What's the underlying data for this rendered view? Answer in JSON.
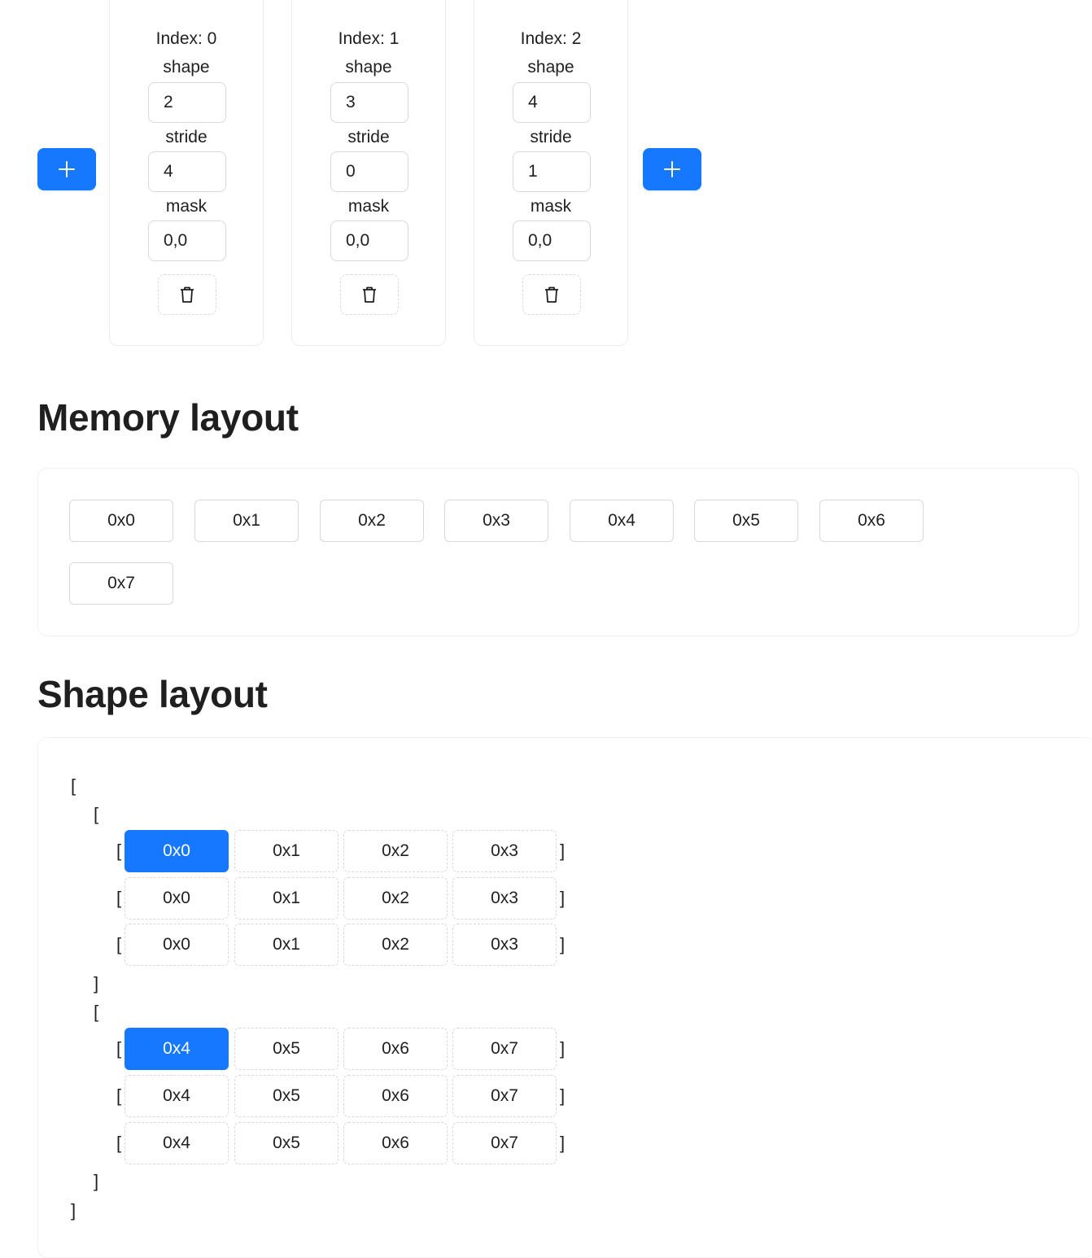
{
  "dimensions": [
    {
      "index_label": "Index: 0",
      "shape_label": "shape",
      "shape_value": "2",
      "stride_label": "stride",
      "stride_value": "4",
      "mask_label": "mask",
      "mask_value": "0,0"
    },
    {
      "index_label": "Index: 1",
      "shape_label": "shape",
      "shape_value": "3",
      "stride_label": "stride",
      "stride_value": "0",
      "mask_label": "mask",
      "mask_value": "0,0"
    },
    {
      "index_label": "Index: 2",
      "shape_label": "shape",
      "shape_value": "4",
      "stride_label": "stride",
      "stride_value": "1",
      "mask_label": "mask",
      "mask_value": "0,0"
    }
  ],
  "icons": {
    "add": "plus-icon",
    "delete": "trash-icon"
  },
  "colors": {
    "accent": "#1677ff",
    "border": "#d9d9d9",
    "text": "#1f1f1f"
  },
  "memory_layout": {
    "title": "Memory layout",
    "cells": [
      "0x0",
      "0x1",
      "0x2",
      "0x3",
      "0x4",
      "0x5",
      "0x6",
      "0x7"
    ]
  },
  "shape_layout": {
    "title": "Shape layout",
    "open_bracket": "[",
    "close_bracket": "]",
    "blocks": [
      {
        "rows": [
          {
            "cells": [
              "0x0",
              "0x1",
              "0x2",
              "0x3"
            ],
            "highlighted": 0
          },
          {
            "cells": [
              "0x0",
              "0x1",
              "0x2",
              "0x3"
            ],
            "highlighted": -1
          },
          {
            "cells": [
              "0x0",
              "0x1",
              "0x2",
              "0x3"
            ],
            "highlighted": -1
          }
        ]
      },
      {
        "rows": [
          {
            "cells": [
              "0x4",
              "0x5",
              "0x6",
              "0x7"
            ],
            "highlighted": 0
          },
          {
            "cells": [
              "0x4",
              "0x5",
              "0x6",
              "0x7"
            ],
            "highlighted": -1
          },
          {
            "cells": [
              "0x4",
              "0x5",
              "0x6",
              "0x7"
            ],
            "highlighted": -1
          }
        ]
      }
    ]
  }
}
